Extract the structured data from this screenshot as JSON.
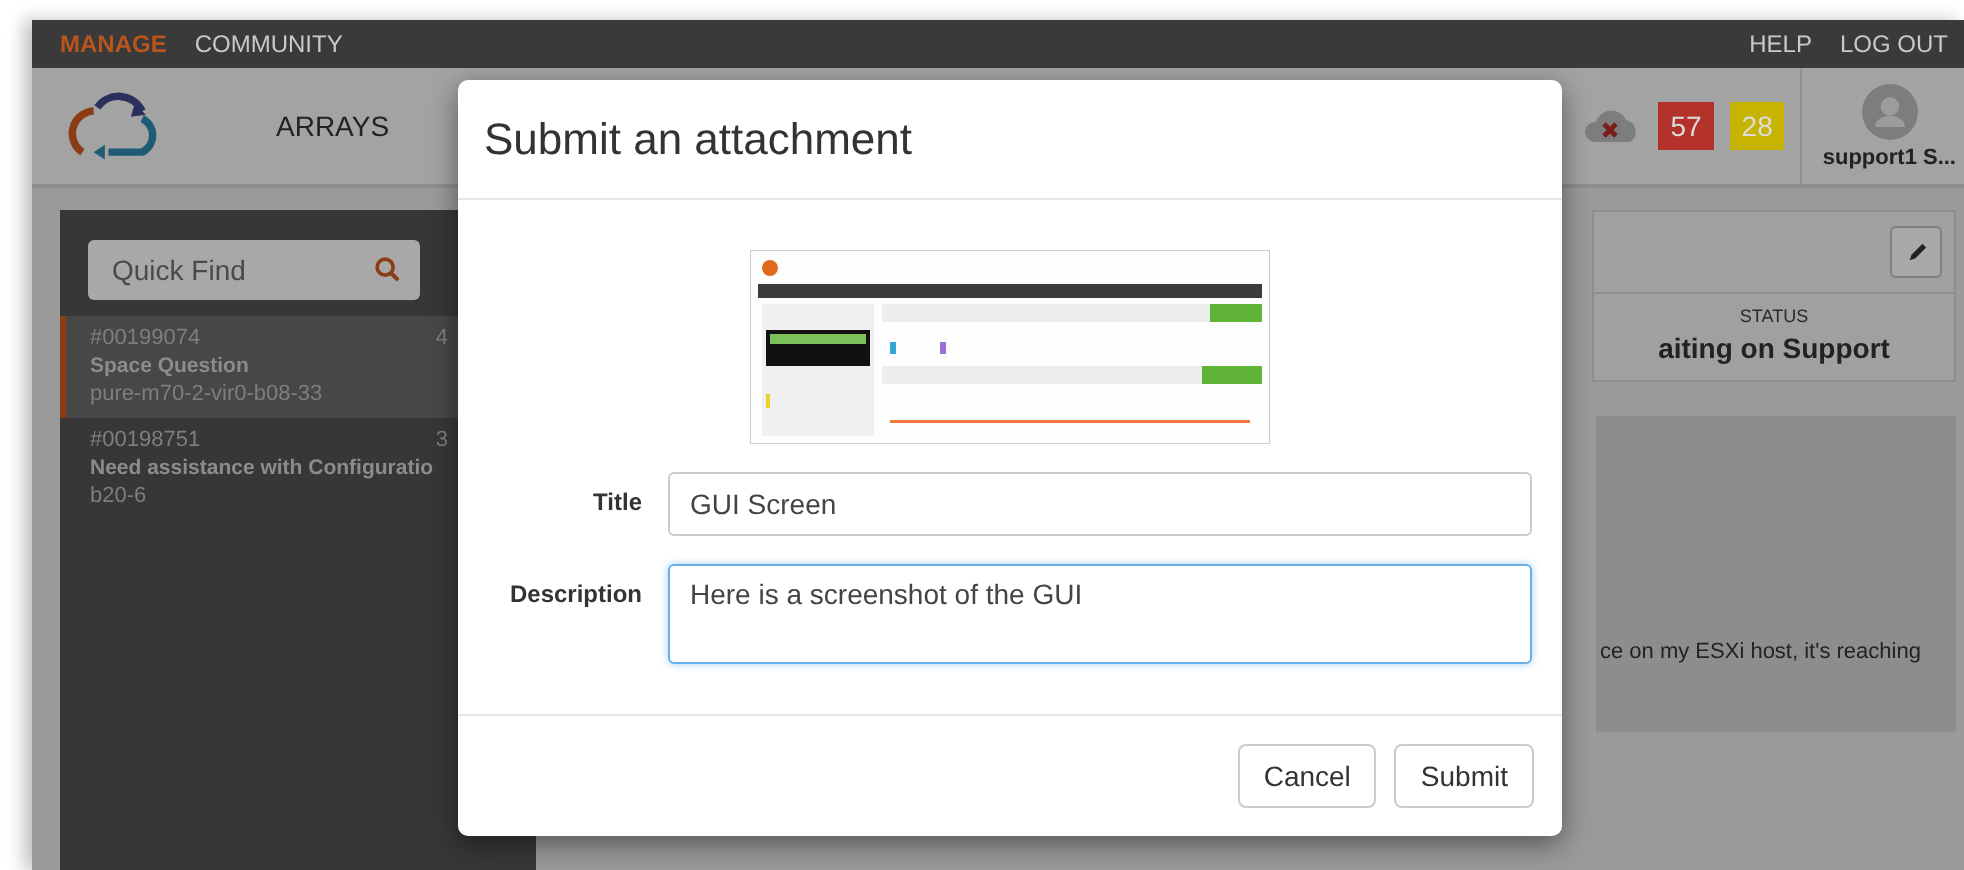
{
  "nav": {
    "items": [
      {
        "label": "MANAGE",
        "selected": true
      },
      {
        "label": "COMMUNITY",
        "selected": false
      }
    ],
    "right": [
      "HELP",
      "LOG OUT"
    ]
  },
  "header": {
    "tab": "ARRAYS",
    "alerts": [
      {
        "count": "57",
        "color": "#b3322b"
      },
      {
        "count": "28",
        "color": "#c7b400"
      }
    ],
    "user": "support1 S..."
  },
  "sidebar": {
    "search": {
      "placeholder": "Quick Find"
    },
    "cases": [
      {
        "number": "#00199074",
        "time": "4",
        "title": "Space Question",
        "subtitle": "pure-m70-2-vir0-b08-33",
        "selected": true
      },
      {
        "number": "#00198751",
        "time": "3",
        "title": "Need assistance with Configuratio",
        "subtitle": "b20-6",
        "selected": false
      }
    ]
  },
  "detail": {
    "status_label": "STATUS",
    "status": "aiting on Support",
    "description": "ce on my ESXi host, it's reaching"
  },
  "modal": {
    "title": "Submit an attachment",
    "fields": [
      {
        "label": "Title",
        "value": "GUI Screen",
        "kind": "input",
        "focused": false
      },
      {
        "label": "Description",
        "value": "Here is a screenshot of the GUI",
        "kind": "textarea",
        "focused": true
      }
    ],
    "buttons": [
      "Cancel",
      "Submit"
    ]
  }
}
